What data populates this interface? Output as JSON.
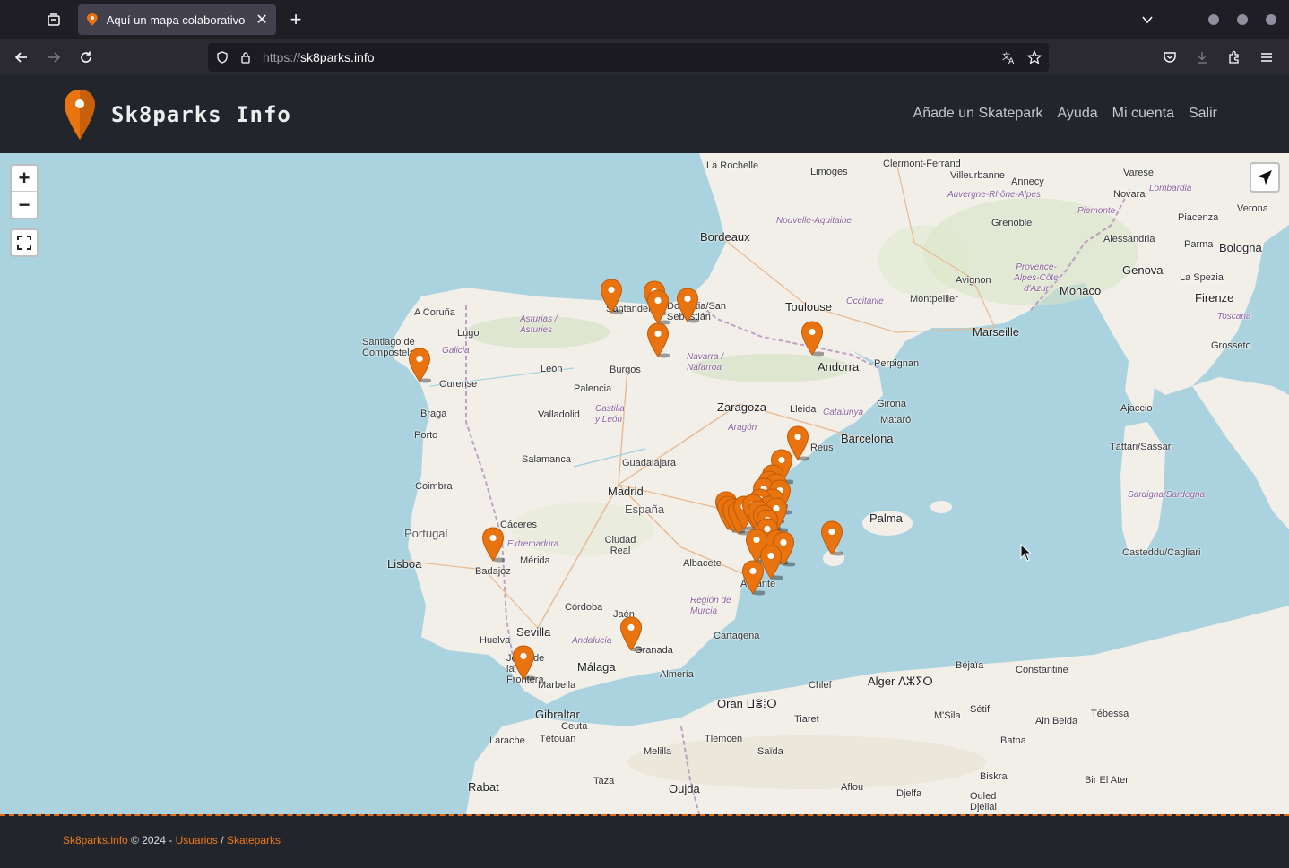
{
  "browser": {
    "tab_title": "Aquí un mapa colaborativo",
    "url_scheme": "https://",
    "url_host": "sk8parks.info"
  },
  "site": {
    "brand": "Sk8parks Info",
    "menu": [
      "Añade un Skatepark",
      "Ayuda",
      "Mi cuenta",
      "Salir"
    ]
  },
  "map": {
    "zoom_in": "+",
    "zoom_out": "−",
    "labels": {
      "big": [
        "Bordeaux",
        "Toulouse",
        "Marseille",
        "Monaco",
        "Genova",
        "Madrid",
        "Barcelona",
        "Zaragoza",
        "Sevilla",
        "Málaga",
        "Granada",
        "Lisboa",
        "Palma",
        "Bologna",
        "Ajaccio",
        "Alger ⴷⵣⵢⵔ",
        "Oran ⵡⴻⵂⵔ"
      ],
      "small": [
        "La Rochelle",
        "Limoges",
        "Clermont-Ferrand",
        "Villeurbanne",
        "Annecy",
        "Grenoble",
        "Avignon",
        "Montpellier",
        "Perpignan",
        "Andorra",
        "Girona",
        "Lleida",
        "Reus",
        "Mataró",
        "A Coruña",
        "Lugo",
        "Santiago de Compostela",
        "Ourense",
        "Braga",
        "Porto",
        "León",
        "Burgos",
        "Palencia",
        "Valladolid",
        "Salamanca",
        "Guadalajara",
        "Coimbra",
        "Cáceres",
        "Mérida",
        "Badajoz",
        "Ciudad Real",
        "Albacete",
        "Córdoba",
        "Jaén",
        "Huelva",
        "Jerez de la Frontera",
        "Marbella",
        "Gibraltar",
        "Almería",
        "Cartagena",
        "Alicante",
        "Santander",
        "Donostia/San Sebastián",
        "Varese",
        "Novara",
        "Verona",
        "Piacenza",
        "Alessandria",
        "Parma",
        "La Spezia",
        "Firenze",
        "Grosseto",
        "Tàttari/Sassari",
        "Casteddu/Cagliari",
        "Tétouan",
        "Larache",
        "Melilla",
        "Tlemcen",
        "Saïda",
        "Tiaret",
        "Sétif",
        "Constantine",
        "Tébessa",
        "Biskra",
        "Rabat",
        "Oujda",
        "Taza",
        "Béjaïa",
        "Chlef",
        "M'Sila",
        "Batna",
        "Bir El Ater",
        "Ouled Djellal",
        "Aflou",
        "Djelfa",
        "Ain Beida",
        "Ceuta"
      ],
      "regions": [
        "Nouvelle-Aquitaine",
        "Auvergne-Rhône-Alpes",
        "Occitanie",
        "Provence-Alpes-Côte d'Azur",
        "Piemonte",
        "Lombardia",
        "Toscana",
        "Asturias / Asturies",
        "Galicia",
        "Navarra / Nafarroa",
        "Castilla y León",
        "Aragón",
        "Catalunya",
        "Extremadura",
        "Andalucía",
        "Región de Murcia",
        "Sardigna/Sardegna"
      ],
      "countries": [
        "Portugal",
        "España"
      ]
    },
    "pin_color": "#e8730f"
  },
  "footer": {
    "site_link": "Sk8parks.info",
    "copyright": " © 2024 - ",
    "users_link": "Usuarios",
    "separator": " / ",
    "skateparks_link": "Skateparks"
  }
}
